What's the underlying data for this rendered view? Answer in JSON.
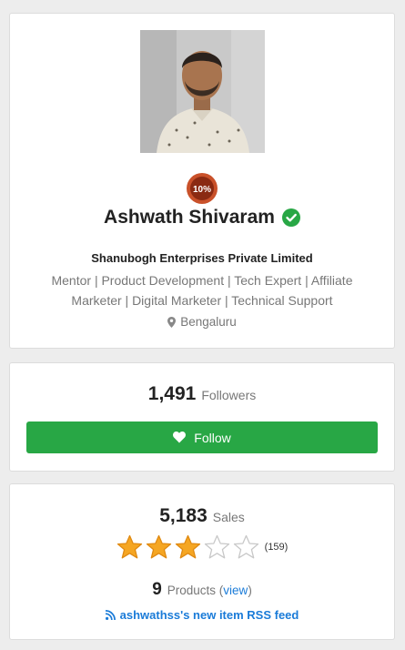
{
  "profile": {
    "name": "Ashwath Shivaram",
    "badge_text": "10%",
    "company": "Shanubogh Enterprises Private Limited",
    "tagline": "Mentor | Product Development | Tech Expert | Affiliate Marketer | Digital Marketer | Technical Support",
    "location": "Bengaluru"
  },
  "followers": {
    "count": "1,491",
    "label": "Followers",
    "follow_button_label": "Follow"
  },
  "sales": {
    "count": "5,183",
    "label": "Sales",
    "rating_filled_stars": 3,
    "rating_max_stars": 5,
    "rating_count": "(159)",
    "products_count": "9",
    "products_label_prefix": "Products (",
    "products_view_link": "view",
    "products_label_suffix": ")",
    "rss_link": "ashwathss's new item RSS feed"
  },
  "colors": {
    "follow_button": "#28a745",
    "link": "#1a7bd8",
    "verified": "#28a745",
    "star_filled": "#f5a623",
    "star_empty": "#ffffff"
  },
  "icons": [
    "verified-check-icon",
    "map-pin-icon",
    "heart-icon",
    "star-icon",
    "rss-icon",
    "discount-badge-icon"
  ]
}
